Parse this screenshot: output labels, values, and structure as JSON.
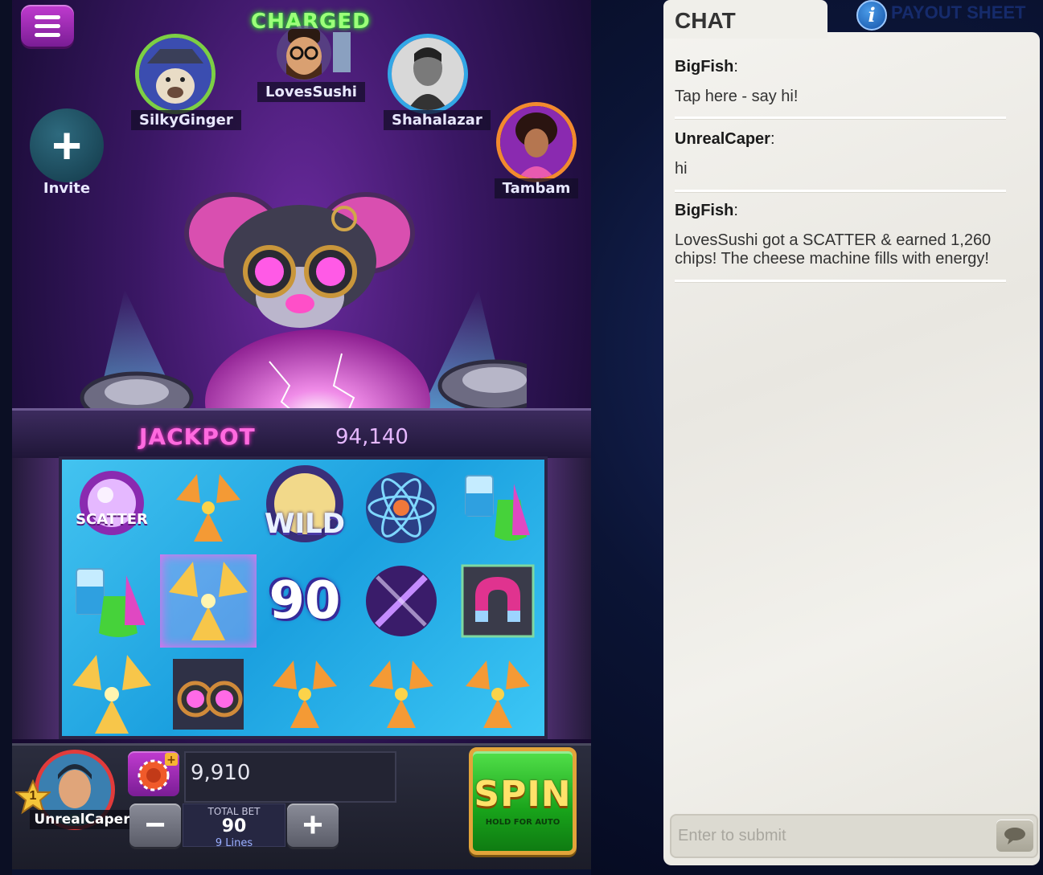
{
  "game": {
    "players": [
      {
        "name": "SilkyGinger"
      },
      {
        "name": "LovesSushi",
        "status": "CHARGED"
      },
      {
        "name": "Shahalazar"
      },
      {
        "name": "Tambam"
      }
    ],
    "invite_label": "Invite",
    "jackpot": {
      "label": "JACKPOT",
      "value": "94,140"
    },
    "reels": {
      "scatter_label": "SCATTER",
      "wild_label": "WILD",
      "win_amount": "90"
    },
    "user": {
      "name": "UnrealCaper",
      "level": "1"
    },
    "balance": "9,910",
    "total_bet": {
      "label": "TOTAL BET",
      "value": "90",
      "lines": "9 Lines"
    },
    "spin": {
      "label": "SPIN",
      "sub_label": "HOLD FOR AUTO"
    }
  },
  "chat": {
    "title": "CHAT",
    "payout_label": "PAYOUT SHEET",
    "messages": [
      {
        "user": "BigFish",
        "text": "Tap here - say hi!"
      },
      {
        "user": "UnrealCaper",
        "text": "hi"
      },
      {
        "user": "BigFish",
        "text": "LovesSushi got a SCATTER & earned 1,260 chips! The cheese machine fills with energy!"
      }
    ],
    "input_placeholder": "Enter to submit"
  },
  "colors": {
    "accent_purple": "#a02ab8",
    "jackpot_pink": "#ff6adf",
    "spin_green": "#2cc02a",
    "chat_bg": "#f0efea"
  }
}
